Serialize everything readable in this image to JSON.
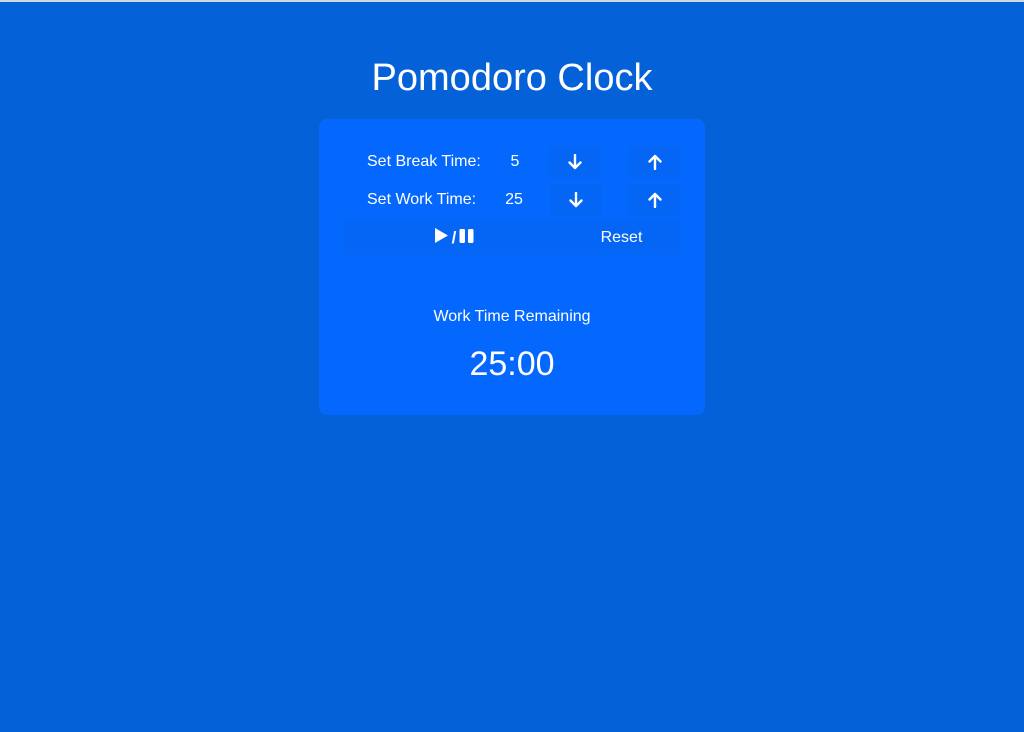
{
  "app": {
    "title": "Pomodoro Clock"
  },
  "settings": {
    "break": {
      "label": "Set Break Time:",
      "value": "5",
      "decrease_icon": "arrow-down-icon",
      "increase_icon": "arrow-up-icon"
    },
    "work": {
      "label": "Set Work Time:",
      "value": "25",
      "decrease_icon": "arrow-down-icon",
      "increase_icon": "arrow-up-icon"
    }
  },
  "controls": {
    "play_icon": "play-icon",
    "separator": "/",
    "pause_icon": "pause-icon",
    "reset_label": "Reset"
  },
  "timer": {
    "status_label": "Work Time Remaining",
    "display": "25:00"
  },
  "colors": {
    "background": "#0561d7",
    "card": "#0468fe",
    "button": "#0566f6",
    "text": "#ffffff"
  }
}
